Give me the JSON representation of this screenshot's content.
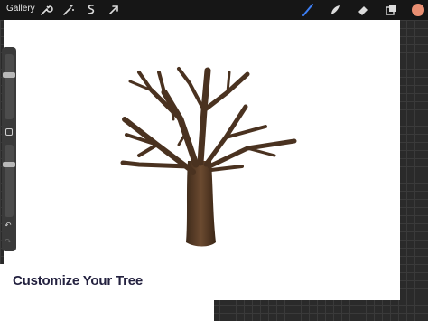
{
  "topbar": {
    "gallery_label": "Gallery",
    "left_tools": [
      "wrench-icon",
      "magic-wand-icon",
      "selection-icon",
      "transform-arrow-icon"
    ],
    "right_tools": [
      "brush-icon",
      "smudge-icon",
      "eraser-icon",
      "layers-icon",
      "color-swatch"
    ],
    "active_tool": "brush-icon",
    "accent_color": "#3d7ff5",
    "swatch_color": "#e98f72"
  },
  "sidebar": {
    "brush_size_level": 0.3,
    "opacity_level": 0.25,
    "undo_label": "↶",
    "redo_label": "↷"
  },
  "canvas": {
    "caption": "Customize Your Tree"
  }
}
